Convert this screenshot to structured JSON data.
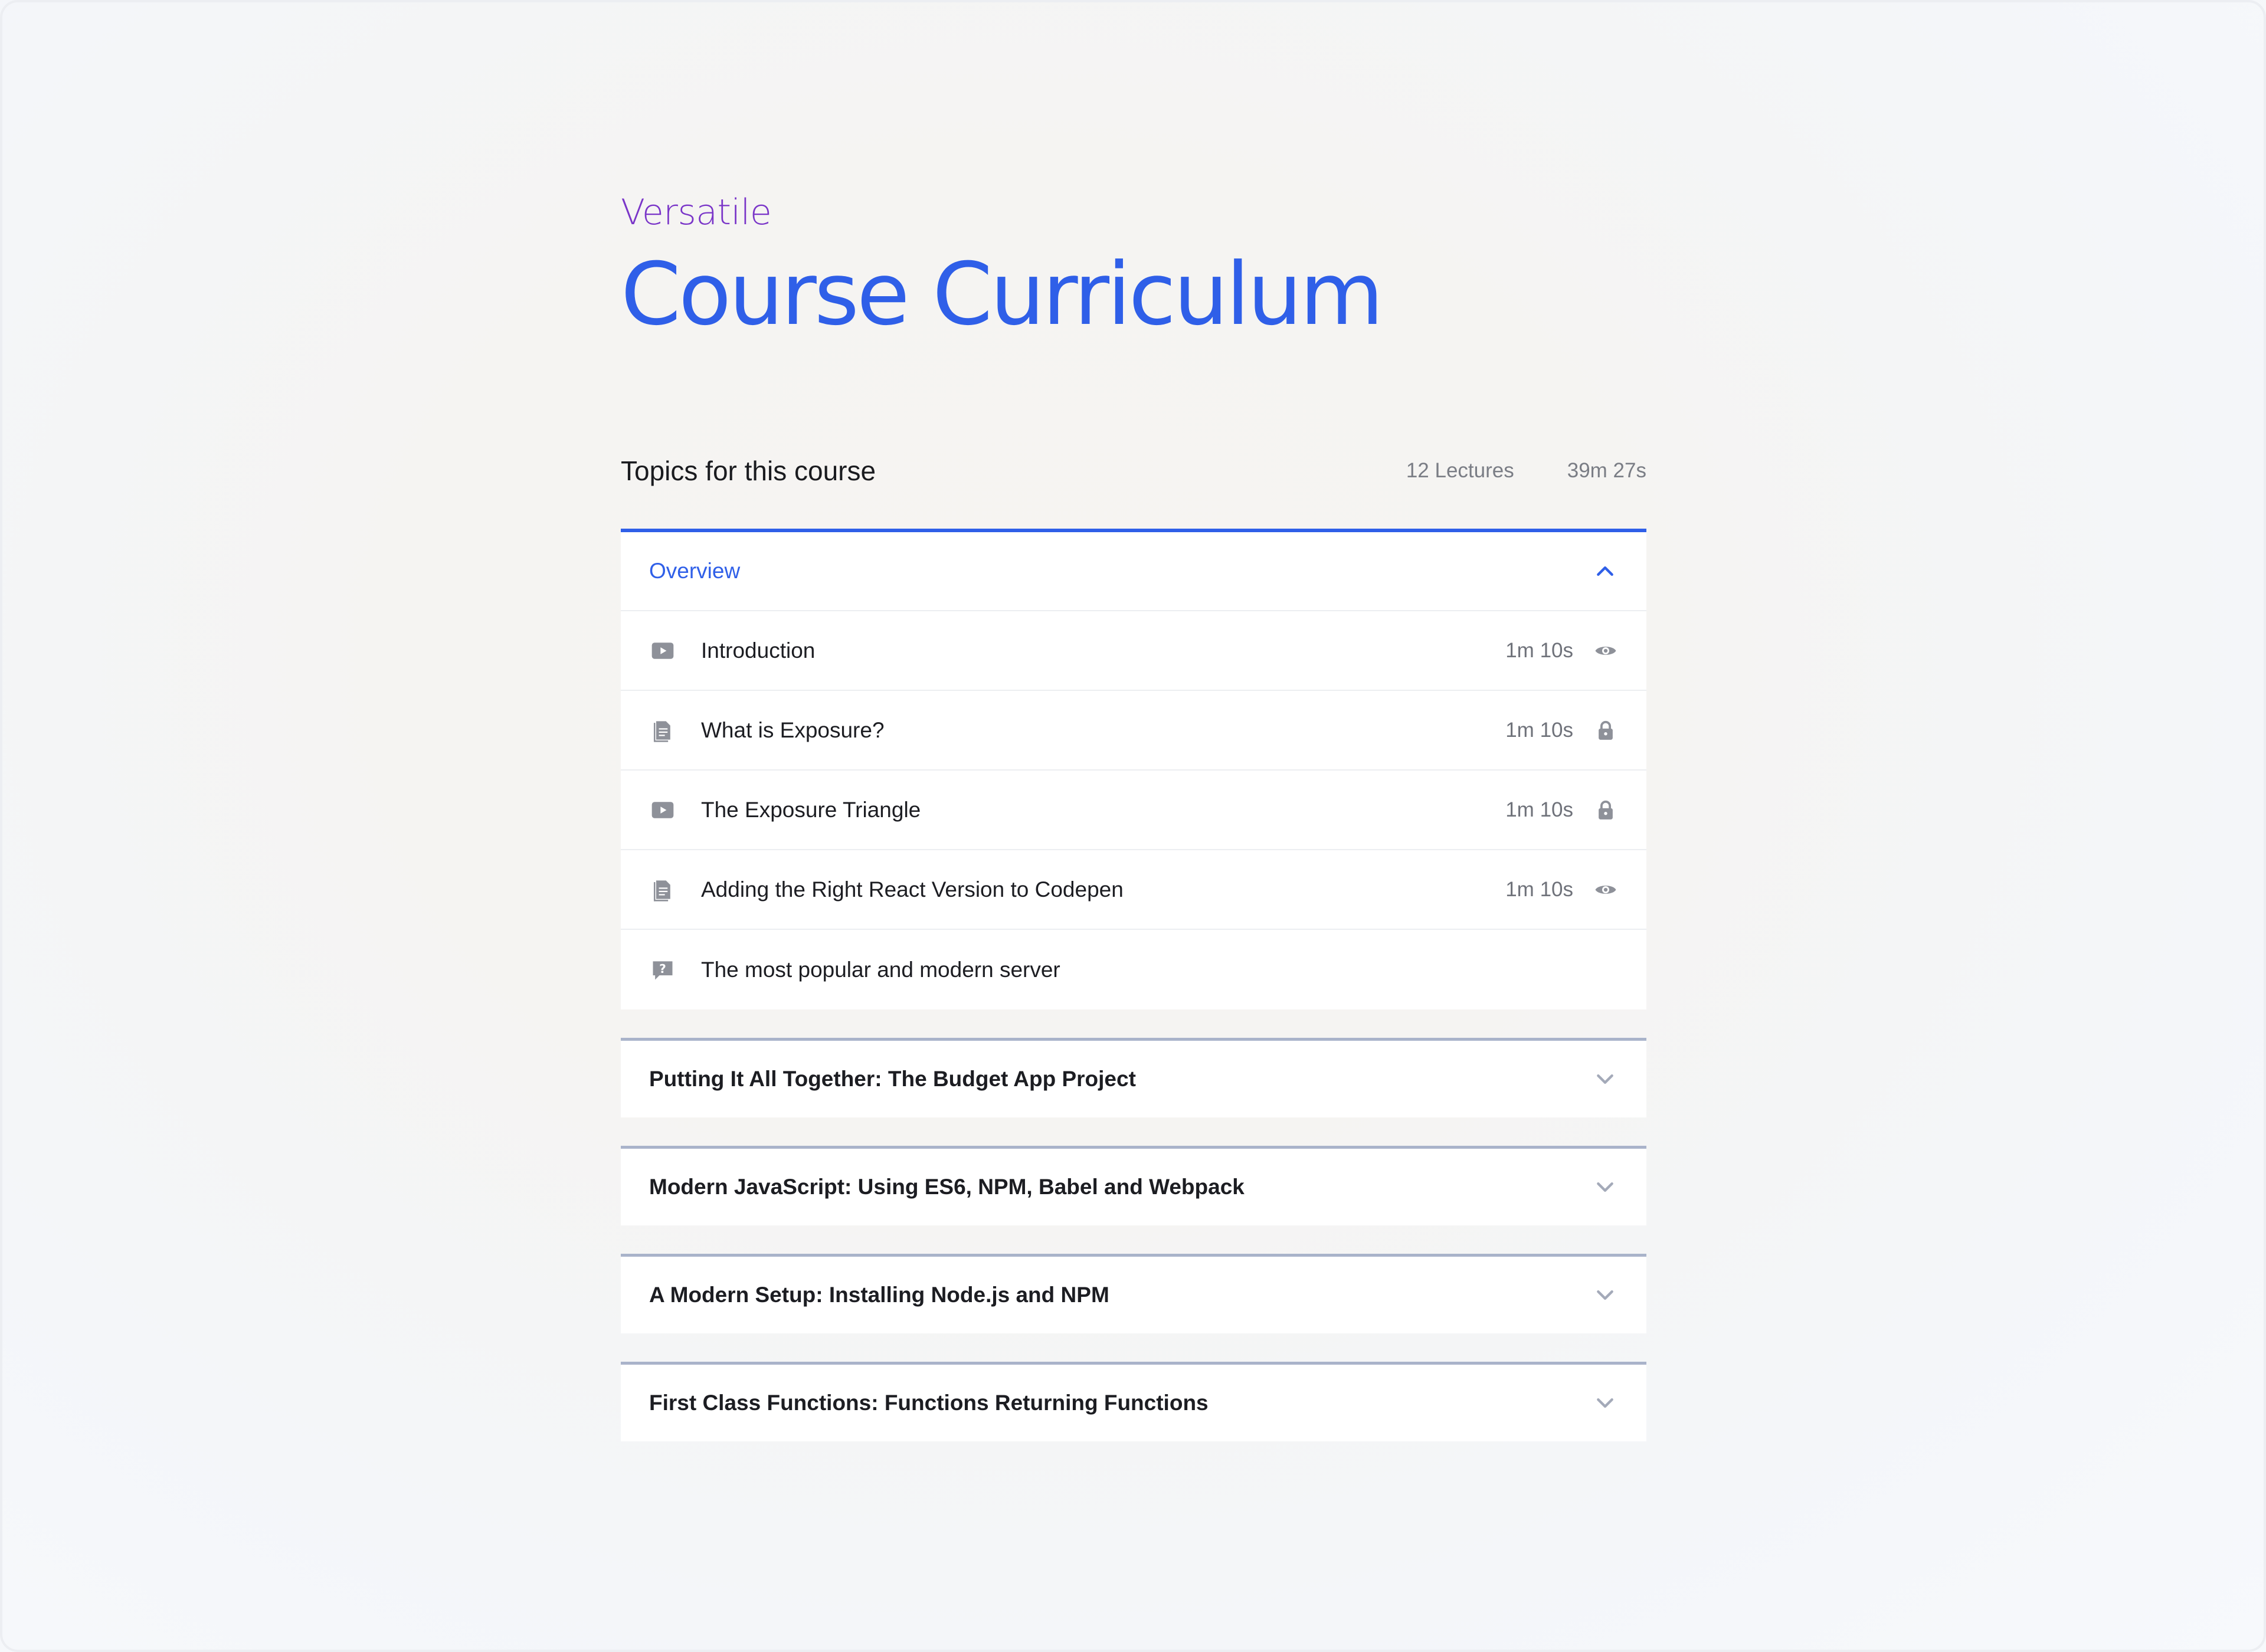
{
  "header": {
    "eyebrow": "Versatile",
    "title": "Course Curriculum"
  },
  "summary": {
    "title": "Topics for this course",
    "lectures": "12 Lectures",
    "duration": "39m 27s"
  },
  "colors": {
    "accent": "#2f5fe8",
    "eyebrow": "#7a35c8",
    "muted": "#7a7d85",
    "icon_gray": "#8e9199",
    "closed_border": "#a9b3ca"
  },
  "sections": [
    {
      "title": "Overview",
      "expanded": true,
      "chevron_icon": "chevron-up-icon",
      "lectures": [
        {
          "title": "Introduction",
          "type_icon": "video-icon",
          "duration": "1m 10s",
          "status_icon": "eye-icon"
        },
        {
          "title": "What is Exposure?",
          "type_icon": "document-icon",
          "duration": "1m 10s",
          "status_icon": "lock-icon"
        },
        {
          "title": "The Exposure Triangle",
          "type_icon": "video-icon",
          "duration": "1m 10s",
          "status_icon": "lock-icon"
        },
        {
          "title": "Adding the Right React Version to Codepen",
          "type_icon": "document-icon",
          "duration": "1m 10s",
          "status_icon": "eye-icon"
        },
        {
          "title": "The most popular and modern server",
          "type_icon": "quiz-icon",
          "duration": "",
          "status_icon": ""
        }
      ]
    },
    {
      "title": "Putting It All Together: The Budget App Project",
      "expanded": false,
      "chevron_icon": "chevron-down-icon"
    },
    {
      "title": "Modern JavaScript: Using ES6, NPM, Babel and Webpack",
      "expanded": false,
      "chevron_icon": "chevron-down-icon"
    },
    {
      "title": "A Modern Setup: Installing Node.js and NPM",
      "expanded": false,
      "chevron_icon": "chevron-down-icon"
    },
    {
      "title": "First Class Functions: Functions Returning Functions",
      "expanded": false,
      "chevron_icon": "chevron-down-icon"
    }
  ]
}
